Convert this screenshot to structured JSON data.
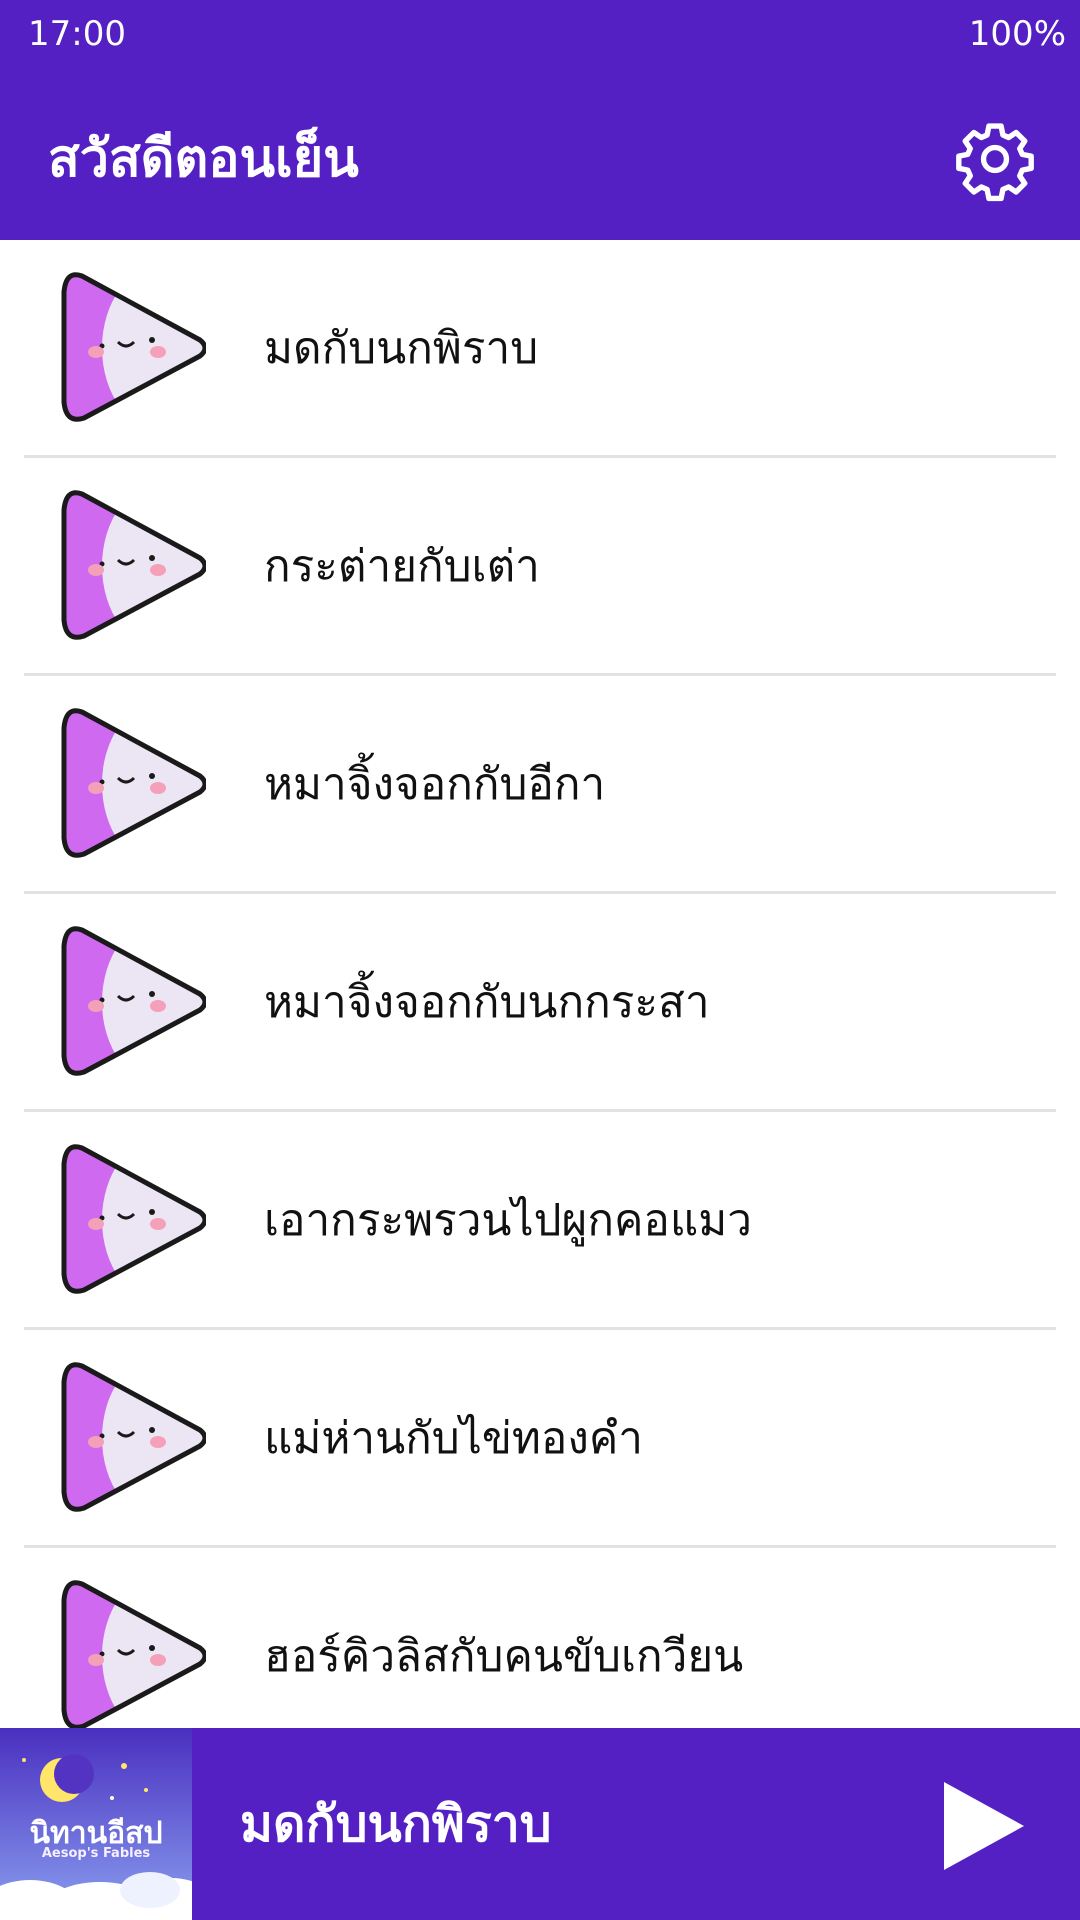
{
  "status_bar": {
    "time": "17:00",
    "battery": "100%"
  },
  "app_bar": {
    "title": "สวัสดีตอนเย็น",
    "settings_icon": "gear-icon"
  },
  "stories": [
    {
      "title": "มดกับนกพิราบ"
    },
    {
      "title": "กระต่ายกับเต่า"
    },
    {
      "title": "หมาจิ้งจอกกับอีกา"
    },
    {
      "title": "หมาจิ้งจอกกับนกกระสา"
    },
    {
      "title": "เอากระพรวนไปผูกคอแมว"
    },
    {
      "title": "แม่ห่านกับไข่ทองคำ"
    },
    {
      "title": "ฮอร์คิวลิสกับคนขับเกวียน"
    }
  ],
  "player": {
    "now_playing": "มดกับนกพิราบ",
    "art_title_thai": "นิทานอีสป",
    "art_title_en": "Aesop's Fables",
    "play_icon": "play-icon"
  },
  "colors": {
    "primary": "#5420c4",
    "thumb_purple": "#cf6af0",
    "thumb_face": "#ece6f4"
  }
}
